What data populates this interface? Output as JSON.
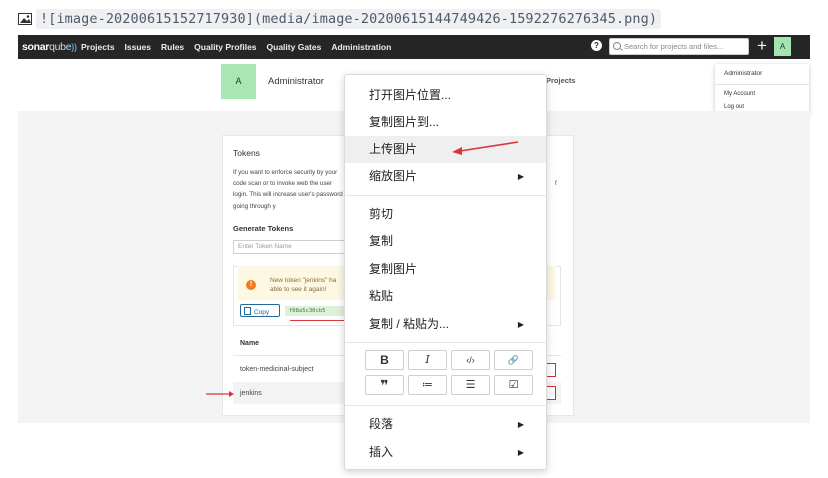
{
  "markdown": {
    "text": "![image-20200615152717930](media/image-20200615144749426-1592276276345.png)"
  },
  "sonar": {
    "logo_main": "sonar",
    "logo_sub": "qube",
    "nav": [
      "Projects",
      "Issues",
      "Rules",
      "Quality Profiles",
      "Quality Gates",
      "Administration"
    ],
    "help_icon": "?",
    "search_placeholder": "Search for projects and files...",
    "plus": "+",
    "avatar_letter": "A"
  },
  "account": {
    "avatar_letter": "A",
    "name": "Administrator",
    "projects_tab": "Projects"
  },
  "account_menu": {
    "title": "Administrator",
    "my_account": "My Account",
    "log_out": "Log out"
  },
  "tokens": {
    "title": "Tokens",
    "description": "If you want to enforce security by your code scan or to invoke web the user login. This will increase user's password going through y",
    "of_fragment": "f",
    "generate_title": "Generate Tokens",
    "input_placeholder": "Enter Token Name",
    "warning_text": "New token \"jenkins\" ha able to see it again!",
    "warning_icon": "!",
    "copy_label": "Copy",
    "token_value": "f08a5c30cb5",
    "column_name": "Name",
    "rows": [
      "token-medicinal-subject",
      "jenkins"
    ]
  },
  "context_menu": {
    "items": [
      {
        "label": "打开图片位置...",
        "submenu": false
      },
      {
        "label": "复制图片到...",
        "submenu": false
      },
      {
        "label": "上传图片",
        "submenu": false,
        "highlighted": true
      },
      {
        "label": "缩放图片",
        "submenu": true
      },
      {
        "label": "剪切",
        "submenu": false
      },
      {
        "label": "复制",
        "submenu": false
      },
      {
        "label": "复制图片",
        "submenu": false
      },
      {
        "label": "粘贴",
        "submenu": false
      },
      {
        "label": "复制 / 粘贴为...",
        "submenu": true
      },
      {
        "label": "段落",
        "submenu": true
      },
      {
        "label": "插入",
        "submenu": true
      }
    ],
    "format_buttons": [
      "B",
      "I",
      "‹/›",
      "🔗",
      "❞",
      "≔",
      "☰",
      "☑"
    ]
  },
  "colors": {
    "annotation_red": "#d9363a",
    "nav_bg": "#262626",
    "avatar_green": "#a3e4b0"
  }
}
